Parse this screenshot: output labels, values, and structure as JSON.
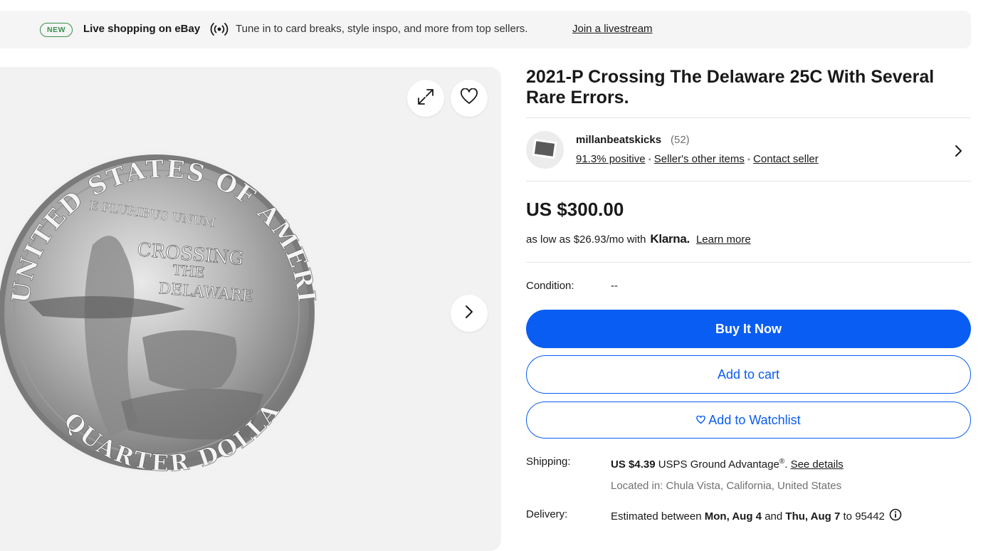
{
  "banner": {
    "badge": "NEW",
    "title": "Live shopping on eBay",
    "text": "Tune in to card breaks, style inspo, and more from top sellers.",
    "link": "Join a livestream",
    "icon": "livestream-icon"
  },
  "gallery": {
    "coin_text": {
      "top": "UNITED STATES OF AMERICA",
      "motto": "E PLURIBUS UNUM",
      "center_1": "CROSSING",
      "center_2": "THE",
      "center_3": "DELAWARE",
      "bottom": "QUARTER DOLLAR"
    },
    "icons": [
      "expand-icon",
      "heart-icon",
      "chevron-right-icon"
    ]
  },
  "listing": {
    "title": "2021-P Crossing The Delaware 25C With Several Rare Errors."
  },
  "seller": {
    "name": "millanbeatskicks",
    "count": "(52)",
    "positive": "91.3% positive",
    "other_items": "Seller's other items",
    "contact": "Contact seller"
  },
  "pricing": {
    "price": "US $300.00",
    "installment_prefix": "as low as $26.93/mo with",
    "klarna": "Klarna.",
    "learn_more": "Learn more"
  },
  "condition": {
    "label": "Condition:",
    "value": "--"
  },
  "buttons": {
    "buy_now": "Buy It Now",
    "add_to_cart": "Add to cart",
    "watchlist": "Add to Watchlist"
  },
  "shipping": {
    "label": "Shipping:",
    "price": "US $4.39",
    "service": "USPS Ground Advantage",
    "reg": "®",
    "period": ".",
    "see_details": "See details",
    "located": "Located in: Chula Vista, California, United States"
  },
  "delivery": {
    "label": "Delivery:",
    "prefix": "Estimated between",
    "start": "Mon, Aug 4",
    "and": "and",
    "end": "Thu, Aug 7",
    "to": "to 95442"
  },
  "colors": {
    "accent": "#0a5df2",
    "badge_green": "#3a8f4d",
    "banner_bg": "#f5f5f5",
    "gallery_bg": "#f2f2f2"
  }
}
